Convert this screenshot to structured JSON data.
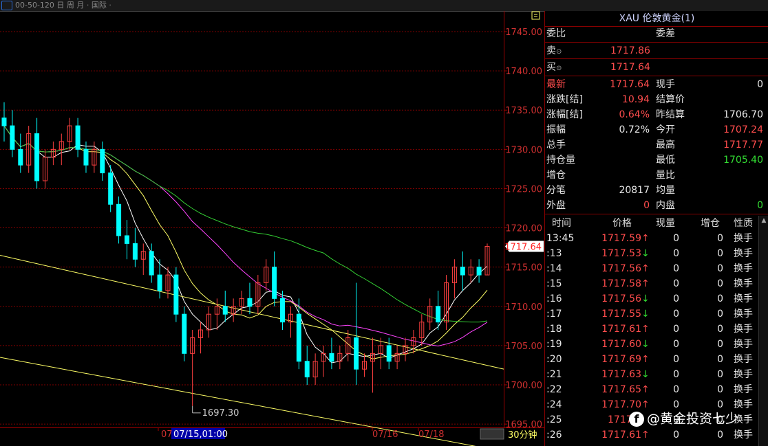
{
  "topbar": {
    "info": "00-50-120 日 周 月 · 国际 ·"
  },
  "chart": {
    "price_axis_ticks": [
      "1745.00",
      "1740.00",
      "1735.00",
      "1730.00",
      "1725.00",
      "1720.00",
      "1715.00",
      "1710.00",
      "1705.00",
      "1700.00",
      "1695.00"
    ],
    "current_price_tag": "1717.64",
    "low_marker": "1697.30",
    "date_labels": [
      "07",
      "07/15,01:00",
      "07/16",
      "07/18"
    ],
    "period_label": "30分钟",
    "colors": {
      "up": "#ff4040",
      "down": "#00ffff",
      "ma5": "#ffffff",
      "ma10": "#ffff66",
      "ma20": "#ff44ff",
      "ma60": "#33cc33",
      "trend": "#ffff66",
      "grid": "#800000"
    }
  },
  "chart_data": {
    "type": "candlestick",
    "title": "XAU 伦敦黄金(1)",
    "period": "30分钟",
    "ylim": [
      1694,
      1750
    ],
    "low_label": 1697.3,
    "last_price": 1717.64,
    "candles": [
      [
        1734,
        1736,
        1731,
        1733
      ],
      [
        1733,
        1735,
        1729,
        1730
      ],
      [
        1730,
        1732,
        1727,
        1728
      ],
      [
        1728,
        1733,
        1727,
        1732
      ],
      [
        1732,
        1734,
        1725,
        1726
      ],
      [
        1726,
        1730,
        1725,
        1729
      ],
      [
        1729,
        1731,
        1728,
        1730
      ],
      [
        1730,
        1732,
        1728,
        1731
      ],
      [
        1731,
        1734,
        1730,
        1733
      ],
      [
        1733,
        1734,
        1729,
        1730
      ],
      [
        1730,
        1731,
        1727,
        1728
      ],
      [
        1728,
        1731,
        1727,
        1730
      ],
      [
        1730,
        1731,
        1726,
        1727
      ],
      [
        1727,
        1728,
        1722,
        1723
      ],
      [
        1723,
        1724,
        1718,
        1719
      ],
      [
        1719,
        1721,
        1716,
        1718
      ],
      [
        1718,
        1720,
        1715,
        1716
      ],
      [
        1716,
        1718,
        1714,
        1717
      ],
      [
        1717,
        1718,
        1713,
        1714
      ],
      [
        1714,
        1716,
        1711,
        1712
      ],
      [
        1712,
        1715,
        1711,
        1714
      ],
      [
        1714,
        1715,
        1708,
        1709
      ],
      [
        1709,
        1710,
        1703,
        1704
      ],
      [
        1704,
        1707,
        1697.3,
        1706
      ],
      [
        1706,
        1708,
        1704,
        1707
      ],
      [
        1707,
        1710,
        1706,
        1709
      ],
      [
        1709,
        1711,
        1707,
        1710
      ],
      [
        1710,
        1712,
        1708,
        1709
      ],
      [
        1709,
        1711,
        1708,
        1710
      ],
      [
        1710,
        1712,
        1709,
        1711
      ],
      [
        1711,
        1713,
        1709,
        1710
      ],
      [
        1710,
        1714,
        1709,
        1713
      ],
      [
        1713,
        1716,
        1712,
        1715
      ],
      [
        1715,
        1717,
        1710,
        1711
      ],
      [
        1711,
        1712,
        1707,
        1708
      ],
      [
        1708,
        1710,
        1706,
        1709
      ],
      [
        1709,
        1711,
        1702,
        1703
      ],
      [
        1703,
        1705,
        1700,
        1701
      ],
      [
        1701,
        1704,
        1700,
        1703
      ],
      [
        1703,
        1705,
        1701,
        1704
      ],
      [
        1704,
        1706,
        1702,
        1703
      ],
      [
        1703,
        1705,
        1702,
        1704
      ],
      [
        1704,
        1707,
        1703,
        1706
      ],
      [
        1706,
        1713,
        1700,
        1702
      ],
      [
        1702,
        1704,
        1701,
        1703
      ],
      [
        1703,
        1706,
        1699,
        1704
      ],
      [
        1704,
        1706,
        1702,
        1705
      ],
      [
        1705,
        1706,
        1702,
        1703
      ],
      [
        1703,
        1705,
        1702,
        1704
      ],
      [
        1704,
        1706,
        1703,
        1705
      ],
      [
        1705,
        1707,
        1704,
        1706
      ],
      [
        1706,
        1709,
        1705,
        1708
      ],
      [
        1708,
        1711,
        1707,
        1710
      ],
      [
        1710,
        1712,
        1707,
        1708
      ],
      [
        1708,
        1714,
        1707,
        1713
      ],
      [
        1713,
        1716,
        1711,
        1715
      ],
      [
        1715,
        1717,
        1712,
        1714
      ],
      [
        1714,
        1716,
        1713,
        1715
      ],
      [
        1715,
        1716,
        1713,
        1714
      ],
      [
        1714,
        1718,
        1714,
        1717.64
      ]
    ],
    "trendlines": [
      [
        1716.5,
        1702
      ],
      [
        1703.5,
        1691.5
      ]
    ]
  },
  "panel": {
    "title": "XAU 伦敦黄金(1)",
    "weibi_label": "委比",
    "weicha_label": "委差",
    "sell_label": "卖",
    "sell_price": "1717.86",
    "buy_label": "买",
    "buy_price": "1717.64",
    "quote": {
      "latest_label": "最新",
      "latest": "1717.64",
      "xianshou_label": "现手",
      "xianshou": "0",
      "change_label": "涨跌[结]",
      "change": "10.94",
      "settle_label": "结算价",
      "settle": "",
      "pct_label": "涨幅[结]",
      "pct": "0.64%",
      "prev_settle_label": "昨结算",
      "prev_settle": "1706.70",
      "amp_label": "振幅",
      "amp": "0.72%",
      "open_label": "今开",
      "open": "1707.24",
      "vol_label": "总手",
      "vol": "",
      "high_label": "最高",
      "high": "1717.77",
      "oi_label": "持仓量",
      "oi": "",
      "low_label": "最低",
      "low": "1705.40",
      "addpos_label": "增仓",
      "ratio_label": "量比",
      "fenbi_label": "分笔",
      "fenbi": "20817",
      "avg_label": "均量",
      "outer_label": "外盘",
      "outer": "0",
      "inner_label": "内盘",
      "inner": "0"
    },
    "ticks_header": [
      "时间",
      "价格",
      "现量",
      "增仓",
      "性质"
    ],
    "ticks": [
      {
        "time": "13:45",
        "price": "1717.59",
        "arrow": "↑",
        "vol": "0",
        "add": "0",
        "type": "换手"
      },
      {
        "time": ":13",
        "price": "1717.53",
        "arrow": "↓",
        "vol": "0",
        "add": "0",
        "type": "换手"
      },
      {
        "time": ":14",
        "price": "1717.56",
        "arrow": "↑",
        "vol": "0",
        "add": "0",
        "type": "换手"
      },
      {
        "time": ":15",
        "price": "1717.58",
        "arrow": "↑",
        "vol": "0",
        "add": "0",
        "type": "换手"
      },
      {
        "time": ":16",
        "price": "1717.56",
        "arrow": "↓",
        "vol": "0",
        "add": "0",
        "type": "换手"
      },
      {
        "time": ":17",
        "price": "1717.55",
        "arrow": "↓",
        "vol": "0",
        "add": "0",
        "type": "换手"
      },
      {
        "time": ":18",
        "price": "1717.61",
        "arrow": "↑",
        "vol": "0",
        "add": "0",
        "type": "换手"
      },
      {
        "time": ":19",
        "price": "1717.60",
        "arrow": "↓",
        "vol": "0",
        "add": "0",
        "type": "换手"
      },
      {
        "time": ":20",
        "price": "1717.69",
        "arrow": "↑",
        "vol": "0",
        "add": "0",
        "type": "换手"
      },
      {
        "time": ":21",
        "price": "1717.63",
        "arrow": "↓",
        "vol": "0",
        "add": "0",
        "type": "换手"
      },
      {
        "time": ":22",
        "price": "1717.65",
        "arrow": "↑",
        "vol": "0",
        "add": "0",
        "type": "换手"
      },
      {
        "time": ":24",
        "price": "1717.70",
        "arrow": "↑",
        "vol": "0",
        "add": "0",
        "type": "换手"
      },
      {
        "time": ":25",
        "price": "1717.5",
        "arrow": "",
        "vol": "0",
        "add": "0",
        "type": "换手"
      },
      {
        "time": ":26",
        "price": "1717.61",
        "arrow": "↑",
        "vol": "0",
        "add": "0",
        "type": "换手"
      }
    ]
  },
  "watermark": {
    "icon": "f",
    "text": "@黄金投资七少"
  }
}
